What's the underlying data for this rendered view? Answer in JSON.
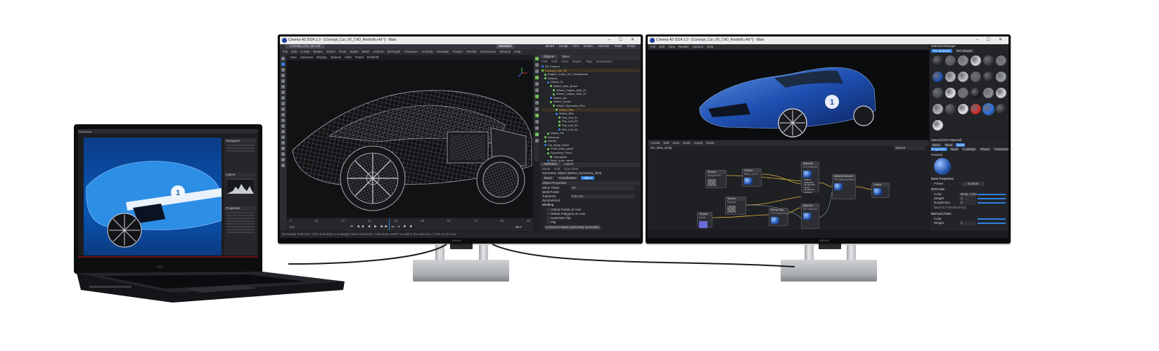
{
  "laptop": {
    "brand": "Asus",
    "app_name": "Photoshop",
    "canvas_badge": "1",
    "panel_labels": [
      "Histogram",
      "Layers",
      "Properties"
    ]
  },
  "monitor_left": {
    "title": "Cinema 4D 2024.1.0 - [Concept_Car_V5_C4D_Redshift.c4d *] - Main",
    "tab": "Concept_Car_V5.c4d",
    "menu": [
      "File",
      "Edit",
      "Create",
      "Modes",
      "Select",
      "Tools",
      "Spline",
      "Mesh",
      "Volume",
      "MoGraph",
      "Character",
      "Animate",
      "Simulate",
      "Tracker",
      "Render",
      "Extensions",
      "Window",
      "Help"
    ],
    "viewport_menu": [
      "View",
      "Cameras",
      "Display",
      "Options",
      "Filter",
      "Panel",
      "Redshift"
    ],
    "layout_label": "Standard",
    "layout_tabs": [
      "Model",
      "Sculpt",
      "UVs",
      "Nodes",
      "Animate",
      "Track",
      "Script"
    ],
    "object_tabs": [
      "Objects",
      "Takes"
    ],
    "object_menu": [
      "File",
      "Edit",
      "View",
      "Object",
      "Tags",
      "Bookmarks"
    ],
    "outliner": [
      "RS Camera",
      "Concept_Car_V5",
      "Engine_Cover_V5_Transformed",
      "Wheels",
      "Wheel_FL",
      "Wheel_Disk_Brake",
      "Wheel_Caliper_Disk_FL",
      "Wheel_Caliper_Disk_FL",
      "Wheel_tire",
      "Wheel_Spoke",
      "Wheel_Symmetry_Rim",
      "Wheel_Rim",
      "Wheel_Bolt",
      "Rim_bolt_01",
      "Rim_bolt_02",
      "Rim_bolt_03",
      "Rim_bolt_04",
      "Wheel_FR",
      "Windows",
      "Interior",
      "Car_Body_Panel",
      "Front_body_panel",
      "Symmetry_Panel",
      "Headlights",
      "Back_body_panel",
      "Floor"
    ],
    "attr_tabs": [
      "Attributes",
      "Layers"
    ],
    "attr_menu": [
      "Mode",
      "Edit",
      "User Data"
    ],
    "attr_object": "Symmetry Object [Wheel_Symmetry_Rim]",
    "attr_subtabs": [
      "Basic",
      "Coordinates",
      "Object"
    ],
    "attr_section": "Object Properties",
    "attr_rows": [
      {
        "label": "Mirror Plane",
        "value": "XY"
      },
      {
        "label": "Weld Points",
        "value": ""
      },
      {
        "label": "Tolerance",
        "value": "0.01 cm"
      },
      {
        "label": "Symmetrical",
        "value": ""
      }
    ],
    "attr_sub": "Welding",
    "attr_checks": [
      "Clamp Points on Axis",
      "Delete Polygons on Axis",
      "Automatic Flip",
      "Flip"
    ],
    "attr_button": "Convert to Basic Symmetry Generator",
    "timeline_start": "0 F",
    "timeline_end": "90 F",
    "frame_ticks": [
      "0",
      "10",
      "20",
      "30",
      "40",
      "50",
      "60",
      "70",
      "80",
      "90"
    ],
    "status": "Rectangle Selection: Click and drag to rectangle-select elements. Hold down SHIFT to add to the selection, CTRL to remove.",
    "monitor_logo": "ASUS"
  },
  "monitor_right": {
    "title": "Cinema 4D 2024.1.0 - [Concept_Car_V5_C4D_Redshift.c4d *] - Main",
    "menu": [
      "File",
      "Edit",
      "View",
      "Render",
      "Options",
      "Help"
    ],
    "car_number": "1",
    "node_editor_menu": [
      "Create",
      "Edit",
      "View",
      "Node",
      "Graph",
      "Mode"
    ],
    "node_breadcrumb": "RS_Blue_Body",
    "search_label": "Search",
    "nodes": [
      {
        "id": "tex1",
        "title": "Texture",
        "sub": "Roughness"
      },
      {
        "id": "tex2",
        "title": "Texture",
        "sub": "Base_Color"
      },
      {
        "id": "mat1",
        "title": "Material",
        "sub": "RS Material"
      },
      {
        "id": "blend",
        "title": "Material Blender",
        "sub": "RS Material Blender"
      },
      {
        "id": "out",
        "title": "Output",
        "sub": ""
      },
      {
        "id": "tex3",
        "title": "Texture",
        "sub": "Normal"
      },
      {
        "id": "tex4",
        "title": "Texture",
        "sub": "Mask"
      },
      {
        "id": "bump",
        "title": "Bump Map",
        "sub": "RS Bump Map"
      },
      {
        "id": "mat2",
        "title": "Material",
        "sub": "RS Material"
      }
    ],
    "node_ports": [
      "Diffuse",
      "Reflection",
      "Roughness",
      "Bump",
      "Metalness",
      "Opacity"
    ],
    "mat_panel_title": "Material Manager",
    "mat_tabs": [
      "RS Material",
      "RS Shader"
    ],
    "attr_title": "Material [RS Material]",
    "attr_tabs": [
      "Basic",
      "Base",
      "Base Properties",
      "Node",
      "Coatings",
      "Sheen",
      "Transmission",
      "Subsurface",
      "Overall"
    ],
    "preview_label": "Preview",
    "base_props": "Base Properties",
    "preset_label": "Preset",
    "preset_value": "Custom",
    "section_diffuse": "DIFFUSE",
    "diffuse_rows": [
      {
        "label": "Color",
        "value": "Body_Color"
      },
      {
        "label": "Weight",
        "value": "1"
      },
      {
        "label": "Roughness",
        "value": "0"
      }
    ],
    "section_reflection": "REFLECTION",
    "reflection_rows": [
      {
        "label": "Color",
        "value": ""
      },
      {
        "label": "Weight",
        "value": "1"
      }
    ],
    "extra_label": "Back-lit (Translucency)",
    "monitor_logo": "ASUS"
  },
  "colors": {
    "accent_blue": "#2f7fe0",
    "node_wire_yellow": "#e0b43a",
    "c4d_green": "#6fbf59",
    "select_orange": "#e08a2e"
  }
}
